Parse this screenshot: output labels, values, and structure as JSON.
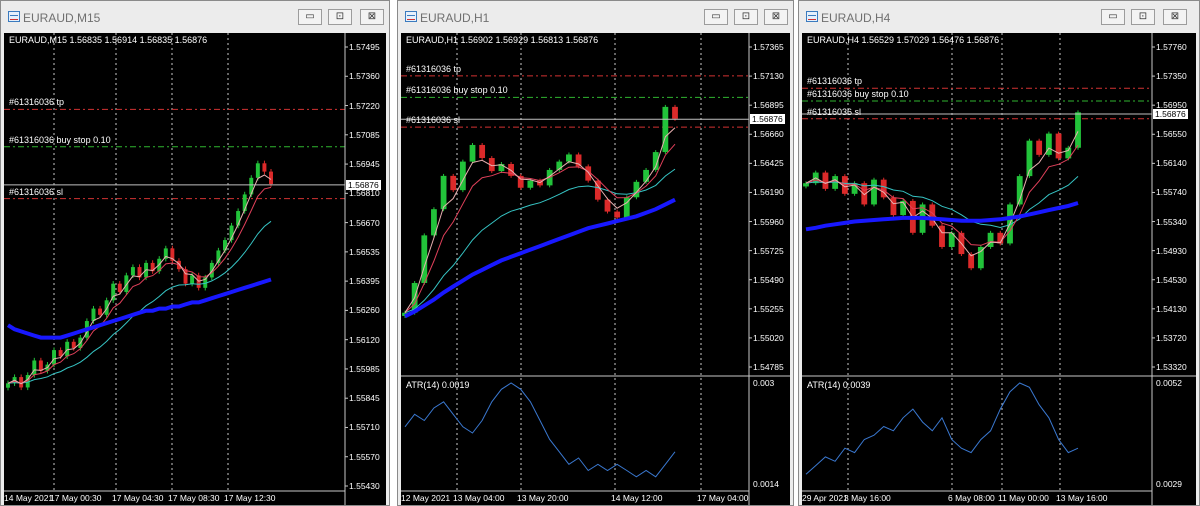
{
  "windows": [
    {
      "title": "EURAUD,M15",
      "header": "EURAUD,M15  1.56835 1.56914 1.56835 1.56876",
      "price_labels": [
        "1.57495",
        "1.57360",
        "1.57220",
        "1.57085",
        "1.56945",
        "1.56810",
        "1.56670",
        "1.56535",
        "1.56395",
        "1.56260",
        "1.56120",
        "1.55985",
        "1.55845",
        "1.55710",
        "1.55570",
        "1.55430"
      ],
      "current_price": "1.56876",
      "orders": [
        {
          "label": "#61316036 tp",
          "price": 1.5724,
          "color": "#d23232"
        },
        {
          "label": "#61316036 buy stop 0.10",
          "price": 1.5706,
          "color": "#2fb52f"
        },
        {
          "label": "#61316036 sl",
          "price": 1.5681,
          "color": "#d23232"
        }
      ],
      "time_labels": [
        "14 May 2021",
        "17 May 00:30",
        "17 May 04:30",
        "17 May 08:30",
        "17 May 12:30"
      ],
      "price_range": [
        1.5543,
        1.5755
      ],
      "series": {
        "close": [
          1.5592,
          1.5595,
          1.559,
          1.5596,
          1.5603,
          1.5598,
          1.5601,
          1.5608,
          1.5605,
          1.5612,
          1.5609,
          1.5614,
          1.5622,
          1.5628,
          1.5625,
          1.5632,
          1.564,
          1.5636,
          1.5644,
          1.5648,
          1.5643,
          1.565,
          1.5646,
          1.5652,
          1.5657,
          1.5651,
          1.5647,
          1.564,
          1.5644,
          1.5638,
          1.5643,
          1.565,
          1.5656,
          1.5661,
          1.5668,
          1.5675,
          1.5683,
          1.5691,
          1.5698,
          1.5694,
          1.5688
        ],
        "ma200": [
          1.562,
          1.5618,
          1.5617,
          1.5616,
          1.5615,
          1.5614,
          1.5614,
          1.5614,
          1.5614,
          1.5615,
          1.5616,
          1.5617,
          1.5618,
          1.5619,
          1.562,
          1.5621,
          1.5622,
          1.5623,
          1.5624,
          1.5625,
          1.5626,
          1.5627,
          1.5627,
          1.5628,
          1.5628,
          1.5629,
          1.5629,
          1.563,
          1.5631,
          1.5631,
          1.5632,
          1.5633,
          1.5634,
          1.5635,
          1.5636,
          1.5637,
          1.5638,
          1.5639,
          1.564,
          1.5641,
          1.5642
        ]
      }
    },
    {
      "title": "EURAUD,H1",
      "header": "EURAUD,H1  1.56902 1.56929 1.56813 1.56876",
      "price_labels": [
        "1.57365",
        "1.57130",
        "1.56895",
        "1.56660",
        "1.56425",
        "1.56190",
        "1.55960",
        "1.55725",
        "1.55490",
        "1.55255",
        "1.55020",
        "1.54785"
      ],
      "current_price": "1.56876",
      "orders": [
        {
          "label": "#61316036 tp",
          "price": 1.5724,
          "color": "#d23232"
        },
        {
          "label": "#61316036 buy stop 0.10",
          "price": 1.5706,
          "color": "#2fb52f"
        },
        {
          "label": "#61316036 sl",
          "price": 1.5681,
          "color": "#d23232"
        }
      ],
      "time_labels": [
        "12 May 2021",
        "13 May 04:00",
        "13 May 20:00",
        "14 May 12:00",
        "17 May 04:00"
      ],
      "price_range": [
        1.5476,
        1.575
      ],
      "indicator": {
        "label": "ATR(14) 0.0019",
        "max": "0.003",
        "min": "0.0014"
      },
      "series": {
        "close": [
          1.5525,
          1.555,
          1.559,
          1.5612,
          1.564,
          1.5628,
          1.5652,
          1.5666,
          1.5655,
          1.5644,
          1.565,
          1.564,
          1.563,
          1.5636,
          1.5632,
          1.5645,
          1.5652,
          1.5658,
          1.5648,
          1.5636,
          1.562,
          1.561,
          1.5605,
          1.5622,
          1.5635,
          1.5645,
          1.566,
          1.5698,
          1.5688
        ],
        "ma200": [
          1.5522,
          1.5526,
          1.5531,
          1.5536,
          1.5542,
          1.5547,
          1.5552,
          1.5557,
          1.5561,
          1.5565,
          1.5569,
          1.5572,
          1.5575,
          1.5578,
          1.5581,
          1.5584,
          1.5587,
          1.559,
          1.5593,
          1.5596,
          1.5598,
          1.56,
          1.5602,
          1.5604,
          1.5606,
          1.5609,
          1.5612,
          1.5616,
          1.562
        ],
        "atr": [
          0.0023,
          0.0025,
          0.0024,
          0.0026,
          0.0027,
          0.0025,
          0.0023,
          0.0022,
          0.0024,
          0.0027,
          0.0029,
          0.003,
          0.0029,
          0.0027,
          0.0024,
          0.0021,
          0.0019,
          0.0017,
          0.0018,
          0.0016,
          0.0017,
          0.0016,
          0.0017,
          0.0016,
          0.0015,
          0.0016,
          0.0015,
          0.0017,
          0.0019
        ]
      }
    },
    {
      "title": "EURAUD,H4",
      "header": "EURAUD,H4  1.56529 1.57029 1.56476 1.56876",
      "price_labels": [
        "1.57760",
        "1.57350",
        "1.56950",
        "1.56550",
        "1.56140",
        "1.55740",
        "1.55340",
        "1.54930",
        "1.54530",
        "1.54130",
        "1.53720",
        "1.53320"
      ],
      "current_price": "1.56876",
      "orders": [
        {
          "label": "#61316036 tp",
          "price": 1.5724,
          "color": "#d23232"
        },
        {
          "label": "#61316036 buy stop 0.10",
          "price": 1.5706,
          "color": "#2fb52f"
        },
        {
          "label": "#61316036 sl",
          "price": 1.5681,
          "color": "#d23232"
        }
      ],
      "time_labels": [
        "29 Apr 2021",
        "3 May 16:00",
        "6 May 08:00",
        "11 May 00:00",
        "13 May 16:00"
      ],
      "price_range": [
        1.5325,
        1.5785
      ],
      "indicator": {
        "label": "ATR(14) 0.0039",
        "max": "0.0052",
        "min": "0.0029"
      },
      "series": {
        "close": [
          1.559,
          1.5605,
          1.5582,
          1.56,
          1.5575,
          1.559,
          1.556,
          1.5595,
          1.557,
          1.5545,
          1.5565,
          1.552,
          1.556,
          1.553,
          1.55,
          1.552,
          1.549,
          1.547,
          1.55,
          1.552,
          1.5505,
          1.556,
          1.56,
          1.565,
          1.563,
          1.566,
          1.5625,
          1.564,
          1.569
        ],
        "ma200": [
          1.5525,
          1.5527,
          1.553,
          1.5532,
          1.5534,
          1.5536,
          1.5537,
          1.5538,
          1.5539,
          1.554,
          1.5541,
          1.5541,
          1.5541,
          1.554,
          1.5539,
          1.5538,
          1.5537,
          1.5537,
          1.5537,
          1.5538,
          1.5539,
          1.5541,
          1.5543,
          1.5546,
          1.5549,
          1.5552,
          1.5555,
          1.5558,
          1.5562
        ],
        "atr": [
          0.0031,
          0.0033,
          0.0035,
          0.0034,
          0.0037,
          0.0036,
          0.0039,
          0.004,
          0.0042,
          0.0041,
          0.0044,
          0.0046,
          0.0043,
          0.0041,
          0.0044,
          0.0039,
          0.0037,
          0.0036,
          0.0039,
          0.0041,
          0.0046,
          0.005,
          0.0052,
          0.0051,
          0.0047,
          0.0044,
          0.0039,
          0.0036,
          0.0037
        ]
      }
    }
  ],
  "window_buttons": {
    "minimize": "▭",
    "maximize": "⊡",
    "close": "⊠"
  },
  "colors": {
    "candle_up": "#22c33a",
    "candle_down": "#dc2a2a",
    "ma_blue": "#1818ff",
    "ma_teal": "#36c4c4",
    "ma_red": "#e0405a",
    "ma_pink": "#e8b0b0",
    "atr": "#3a78d0",
    "grid": "#c8c8c8"
  }
}
